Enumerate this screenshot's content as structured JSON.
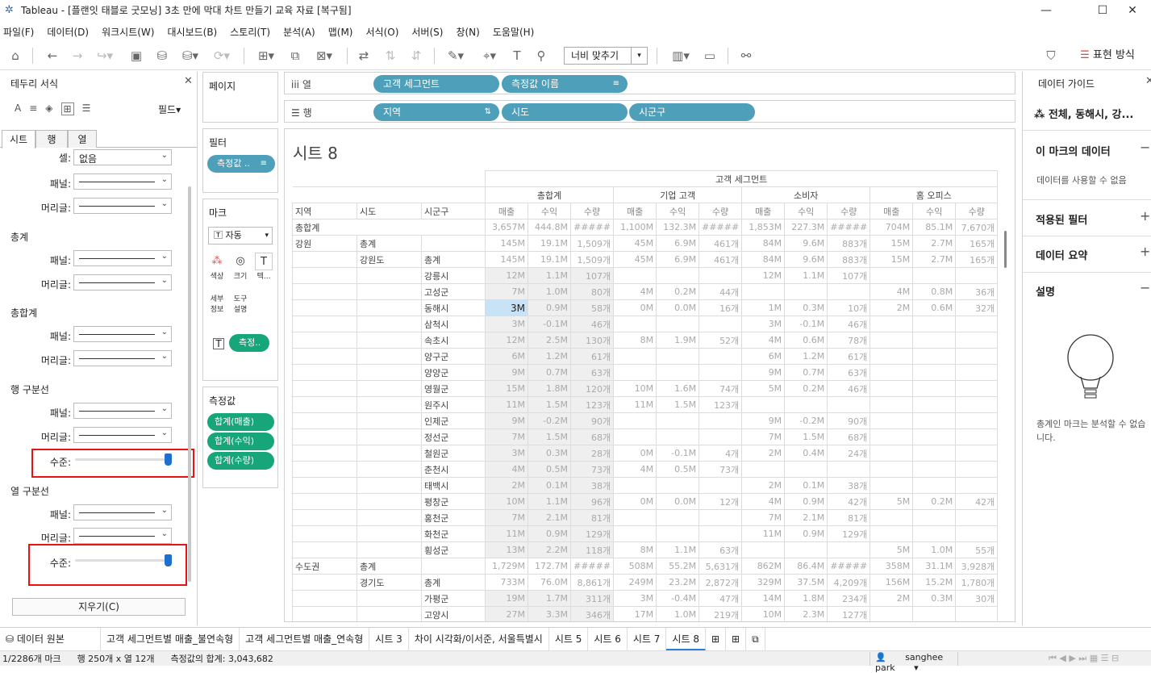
{
  "window": {
    "title": "Tableau - [플랜잇 태블로 굿모닝] 3초 만에 막대 차트 만들기 교육 자료 [복구됨]",
    "app_icon": "tableau-logo-icon"
  },
  "menu": [
    "파일(F)",
    "데이터(D)",
    "워크시트(W)",
    "대시보드(B)",
    "스토리(T)",
    "분석(A)",
    "맵(M)",
    "서식(O)",
    "서버(S)",
    "창(N)",
    "도움말(H)"
  ],
  "toolbar": {
    "fit": "너비 맞추기",
    "show_me": "표현 방식"
  },
  "left_panel": {
    "title": "테두리 서식",
    "fields_button": "필드",
    "tabs": [
      "시트",
      "행",
      "열"
    ],
    "cell_label": "셀:",
    "cell_value": "없음",
    "pane_label": "패널:",
    "header_label": "머리글:",
    "level_label": "수준:",
    "sections": [
      "총계",
      "총합계",
      "행 구분선",
      "열 구분선"
    ],
    "clear_button": "지우기(C)"
  },
  "pages_card": {
    "title": "페이지"
  },
  "filters_card": {
    "title": "필터",
    "pill": "측정값 .."
  },
  "marks_card": {
    "title": "마크",
    "type": "자동",
    "buttons": [
      "색상",
      "크기",
      "텍...",
      "세부 정보",
      "도구 설명"
    ],
    "text_pill": "측정.."
  },
  "measure_values_card": {
    "title": "측정값",
    "pills": [
      "합계(매출)",
      "합계(수익)",
      "합계(수량)"
    ]
  },
  "columns_shelf": {
    "label": "열",
    "pills": [
      "고객 세그먼트",
      "측정값 이름"
    ]
  },
  "rows_shelf": {
    "label": "행",
    "pills": [
      "지역",
      "시도",
      "시군구"
    ]
  },
  "sheet": {
    "title": "시트 8"
  },
  "crosstab": {
    "top_header": "고객 세그먼트",
    "segments": [
      "총합계",
      "기업 고객",
      "소비자",
      "홈 오피스"
    ],
    "row_headers": [
      "지역",
      "시도",
      "시군구"
    ],
    "measures": [
      "매출",
      "수익",
      "수량"
    ],
    "grand_total_label": "총합계",
    "rows": [
      {
        "r": "총합계",
        "s": "",
        "c": "",
        "v": [
          "3,657M",
          "444.8M",
          "#####",
          "1,100M",
          "132.3M",
          "#####",
          "1,853M",
          "227.3M",
          "#####",
          "704M",
          "85.1M",
          "7,670개"
        ]
      },
      {
        "r": "강원",
        "s": "총계",
        "c": "",
        "v": [
          "145M",
          "19.1M",
          "1,509개",
          "45M",
          "6.9M",
          "461개",
          "84M",
          "9.6M",
          "883개",
          "15M",
          "2.7M",
          "165개"
        ]
      },
      {
        "r": "",
        "s": "강원도",
        "c": "총계",
        "v": [
          "145M",
          "19.1M",
          "1,509개",
          "45M",
          "6.9M",
          "461개",
          "84M",
          "9.6M",
          "883개",
          "15M",
          "2.7M",
          "165개"
        ]
      },
      {
        "r": "",
        "s": "",
        "c": "강릉시",
        "v": [
          "12M",
          "1.1M",
          "107개",
          "",
          "",
          "",
          "12M",
          "1.1M",
          "107개",
          "",
          "",
          ""
        ]
      },
      {
        "r": "",
        "s": "",
        "c": "고성군",
        "v": [
          "7M",
          "1.0M",
          "80개",
          "4M",
          "0.2M",
          "44개",
          "",
          "",
          "",
          "4M",
          "0.8M",
          "36개"
        ]
      },
      {
        "r": "",
        "s": "",
        "c": "동해시",
        "v": [
          "3M",
          "0.9M",
          "58개",
          "0M",
          "0.0M",
          "16개",
          "1M",
          "0.3M",
          "10개",
          "2M",
          "0.6M",
          "32개"
        ]
      },
      {
        "r": "",
        "s": "",
        "c": "삼척시",
        "v": [
          "3M",
          "-0.1M",
          "46개",
          "",
          "",
          "",
          "3M",
          "-0.1M",
          "46개",
          "",
          "",
          ""
        ]
      },
      {
        "r": "",
        "s": "",
        "c": "속초시",
        "v": [
          "12M",
          "2.5M",
          "130개",
          "8M",
          "1.9M",
          "52개",
          "4M",
          "0.6M",
          "78개",
          "",
          "",
          ""
        ]
      },
      {
        "r": "",
        "s": "",
        "c": "양구군",
        "v": [
          "6M",
          "1.2M",
          "61개",
          "",
          "",
          "",
          "6M",
          "1.2M",
          "61개",
          "",
          "",
          ""
        ]
      },
      {
        "r": "",
        "s": "",
        "c": "양양군",
        "v": [
          "9M",
          "0.7M",
          "63개",
          "",
          "",
          "",
          "9M",
          "0.7M",
          "63개",
          "",
          "",
          ""
        ]
      },
      {
        "r": "",
        "s": "",
        "c": "영월군",
        "v": [
          "15M",
          "1.8M",
          "120개",
          "10M",
          "1.6M",
          "74개",
          "5M",
          "0.2M",
          "46개",
          "",
          "",
          ""
        ]
      },
      {
        "r": "",
        "s": "",
        "c": "원주시",
        "v": [
          "11M",
          "1.5M",
          "123개",
          "11M",
          "1.5M",
          "123개",
          "",
          "",
          "",
          "",
          "",
          ""
        ]
      },
      {
        "r": "",
        "s": "",
        "c": "인제군",
        "v": [
          "9M",
          "-0.2M",
          "90개",
          "",
          "",
          "",
          "9M",
          "-0.2M",
          "90개",
          "",
          "",
          ""
        ]
      },
      {
        "r": "",
        "s": "",
        "c": "정선군",
        "v": [
          "7M",
          "1.5M",
          "68개",
          "",
          "",
          "",
          "7M",
          "1.5M",
          "68개",
          "",
          "",
          ""
        ]
      },
      {
        "r": "",
        "s": "",
        "c": "철원군",
        "v": [
          "3M",
          "0.3M",
          "28개",
          "0M",
          "-0.1M",
          "4개",
          "2M",
          "0.4M",
          "24개",
          "",
          "",
          ""
        ]
      },
      {
        "r": "",
        "s": "",
        "c": "춘천시",
        "v": [
          "4M",
          "0.5M",
          "73개",
          "4M",
          "0.5M",
          "73개",
          "",
          "",
          "",
          "",
          "",
          ""
        ]
      },
      {
        "r": "",
        "s": "",
        "c": "태백시",
        "v": [
          "2M",
          "0.1M",
          "38개",
          "",
          "",
          "",
          "2M",
          "0.1M",
          "38개",
          "",
          "",
          ""
        ]
      },
      {
        "r": "",
        "s": "",
        "c": "평창군",
        "v": [
          "10M",
          "1.1M",
          "96개",
          "0M",
          "0.0M",
          "12개",
          "4M",
          "0.9M",
          "42개",
          "5M",
          "0.2M",
          "42개"
        ]
      },
      {
        "r": "",
        "s": "",
        "c": "홍천군",
        "v": [
          "7M",
          "2.1M",
          "81개",
          "",
          "",
          "",
          "7M",
          "2.1M",
          "81개",
          "",
          "",
          ""
        ]
      },
      {
        "r": "",
        "s": "",
        "c": "화천군",
        "v": [
          "11M",
          "0.9M",
          "129개",
          "",
          "",
          "",
          "11M",
          "0.9M",
          "129개",
          "",
          "",
          ""
        ]
      },
      {
        "r": "",
        "s": "",
        "c": "횡성군",
        "v": [
          "13M",
          "2.2M",
          "118개",
          "8M",
          "1.1M",
          "63개",
          "",
          "",
          "",
          "5M",
          "1.0M",
          "55개"
        ]
      },
      {
        "r": "수도권",
        "s": "총계",
        "c": "",
        "v": [
          "1,729M",
          "172.7M",
          "#####",
          "508M",
          "55.2M",
          "5,631개",
          "862M",
          "86.4M",
          "#####",
          "358M",
          "31.1M",
          "3,928개"
        ]
      },
      {
        "r": "",
        "s": "경기도",
        "c": "총계",
        "v": [
          "733M",
          "76.0M",
          "8,861개",
          "249M",
          "23.2M",
          "2,872개",
          "329M",
          "37.5M",
          "4,209개",
          "156M",
          "15.2M",
          "1,780개"
        ]
      },
      {
        "r": "",
        "s": "",
        "c": "가평군",
        "v": [
          "19M",
          "1.7M",
          "311개",
          "3M",
          "-0.4M",
          "47개",
          "14M",
          "1.8M",
          "234개",
          "2M",
          "0.3M",
          "30개"
        ]
      },
      {
        "r": "",
        "s": "",
        "c": "고양시",
        "v": [
          "27M",
          "3.3M",
          "346개",
          "17M",
          "1.0M",
          "219개",
          "10M",
          "2.3M",
          "127개",
          "",
          "",
          ""
        ]
      }
    ]
  },
  "right_panel": {
    "title": "데이터 가이드",
    "context": "전체, 동해시, 강...",
    "sections": [
      "이 마크의 데이터",
      "적용된 필터",
      "데이터 요약",
      "설명"
    ],
    "no_data_text": "데이터를 사용할 수 없음",
    "tip_text": "총계인 마크는 분석할 수 없습니다."
  },
  "sheet_tabs": [
    "데이터 원본",
    "고객 세그먼트별 매출_불연속형",
    "고객 세그먼트별 매출_연속형",
    "시트 3",
    "차이 시각화/이서준, 서울특별시",
    "시트 5",
    "시트 6",
    "시트 7",
    "시트 8"
  ],
  "status": {
    "marks": "1/2286개 마크",
    "rows_cols": "행 250개 x 열 12개",
    "sum": "측정값의 합계: 3,043,682",
    "user": "sanghee park"
  }
}
